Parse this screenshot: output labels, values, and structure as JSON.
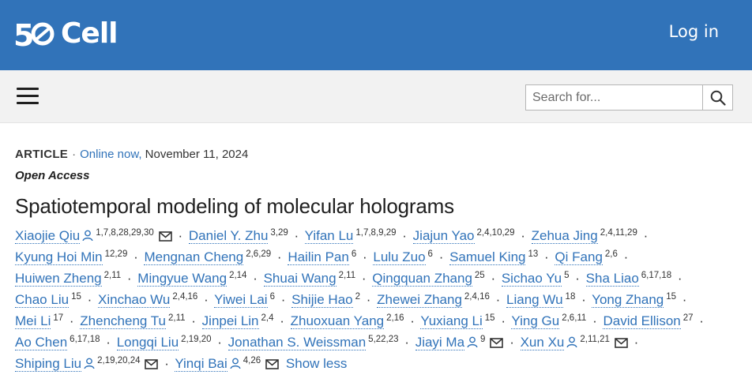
{
  "header": {
    "logo_text": "Cell",
    "logo_mark": "50",
    "login_label": "Log in"
  },
  "toolbar": {
    "menu_icon": "hamburger-icon",
    "search_placeholder": "Search for...",
    "search_icon": "search-icon"
  },
  "article": {
    "type": "ARTICLE",
    "online_label": "Online now,",
    "date": "November 11, 2024",
    "access": "Open Access",
    "title": "Spatiotemporal modeling of molecular holograms",
    "show_less_label": "Show less"
  },
  "authors": [
    {
      "name": "Xiaojie Qiu",
      "sup": "1,7,8,28,29,30",
      "person": true,
      "email": true
    },
    {
      "name": "Daniel Y. Zhu",
      "sup": "3,29"
    },
    {
      "name": "Yifan Lu",
      "sup": "1,7,8,9,29"
    },
    {
      "name": "Jiajun Yao",
      "sup": "2,4,10,29"
    },
    {
      "name": "Zehua Jing",
      "sup": "2,4,11,29"
    },
    {
      "name": "Kyung Hoi Min",
      "sup": "12,29"
    },
    {
      "name": "Mengnan Cheng",
      "sup": "2,6,29"
    },
    {
      "name": "Hailin Pan",
      "sup": "6"
    },
    {
      "name": "Lulu Zuo",
      "sup": "6"
    },
    {
      "name": "Samuel King",
      "sup": "13"
    },
    {
      "name": "Qi Fang",
      "sup": "2,6"
    },
    {
      "name": "Huiwen Zheng",
      "sup": "2,11"
    },
    {
      "name": "Mingyue Wang",
      "sup": "2,14"
    },
    {
      "name": "Shuai Wang",
      "sup": "2,11"
    },
    {
      "name": "Qingquan Zhang",
      "sup": "25"
    },
    {
      "name": "Sichao Yu",
      "sup": "5"
    },
    {
      "name": "Sha Liao",
      "sup": "6,17,18"
    },
    {
      "name": "Chao Liu",
      "sup": "15"
    },
    {
      "name": "Xinchao Wu",
      "sup": "2,4,16"
    },
    {
      "name": "Yiwei Lai",
      "sup": "6"
    },
    {
      "name": "Shijie Hao",
      "sup": "2"
    },
    {
      "name": "Zhewei Zhang",
      "sup": "2,4,16"
    },
    {
      "name": "Liang Wu",
      "sup": "18"
    },
    {
      "name": "Yong Zhang",
      "sup": "15"
    },
    {
      "name": "Mei Li",
      "sup": "17"
    },
    {
      "name": "Zhencheng Tu",
      "sup": "2,11"
    },
    {
      "name": "Jinpei Lin",
      "sup": "2,4"
    },
    {
      "name": "Zhuoxuan Yang",
      "sup": "2,16"
    },
    {
      "name": "Yuxiang Li",
      "sup": "15"
    },
    {
      "name": "Ying Gu",
      "sup": "2,6,11"
    },
    {
      "name": "David Ellison",
      "sup": "27"
    },
    {
      "name": "Ao Chen",
      "sup": "6,17,18"
    },
    {
      "name": "Longqi Liu",
      "sup": "2,19,20"
    },
    {
      "name": "Jonathan S. Weissman",
      "sup": "5,22,23"
    },
    {
      "name": "Jiayi Ma",
      "sup": "9",
      "person": true,
      "email": true
    },
    {
      "name": "Xun Xu",
      "sup": "2,11,21",
      "person": true,
      "email": true
    },
    {
      "name": "Shiping Liu",
      "sup": "2,19,20,24",
      "person": true,
      "email": true
    },
    {
      "name": "Yinqi Bai",
      "sup": "4,26",
      "person": true,
      "email": true
    }
  ],
  "colors": {
    "brand_blue": "#3173b9",
    "toolbar_bg": "#f2f2f2"
  }
}
